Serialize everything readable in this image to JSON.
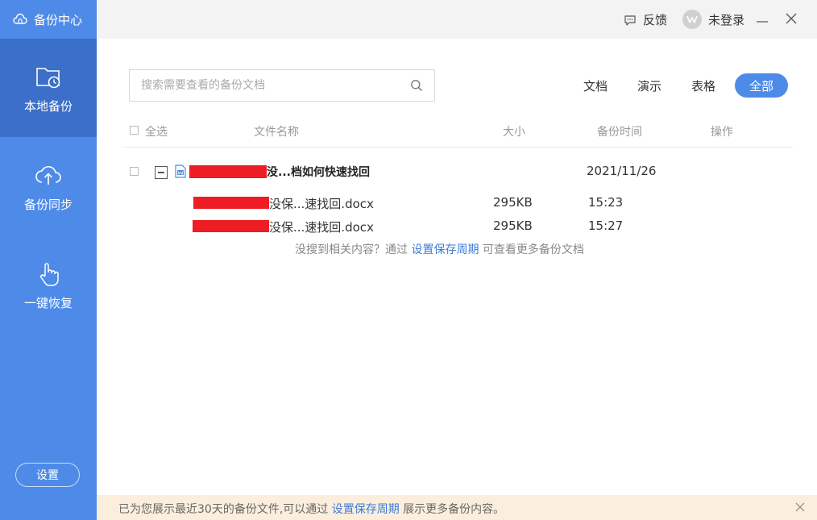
{
  "app": {
    "title": "备份中心"
  },
  "sidebar": {
    "items": [
      {
        "label": "本地备份",
        "icon": "folder-clock-icon",
        "active": true
      },
      {
        "label": "备份同步",
        "icon": "cloud-upload-icon",
        "active": false
      },
      {
        "label": "一键恢复",
        "icon": "hand-pointer-icon",
        "active": false
      }
    ],
    "settings_label": "设置"
  },
  "titlebar": {
    "feedback_label": "反馈",
    "user_label": "未登录",
    "avatar_letter": "W"
  },
  "search": {
    "placeholder": "搜索需要查看的备份文档"
  },
  "filters": [
    {
      "label": "文档",
      "active": false
    },
    {
      "label": "演示",
      "active": false
    },
    {
      "label": "表格",
      "active": false
    },
    {
      "label": "全部",
      "active": true
    }
  ],
  "table": {
    "headers": {
      "select_all": "全选",
      "name": "文件名称",
      "size": "大小",
      "time": "备份时间",
      "action": "操作"
    },
    "group": {
      "name": "没...档如何快速找回",
      "date": "2021/11/26",
      "files": [
        {
          "name": "没保...速找回.docx",
          "size": "295KB",
          "time": "15:23"
        },
        {
          "name": "没保...速找回.docx",
          "size": "295KB",
          "time": "15:27"
        }
      ]
    }
  },
  "hint": {
    "prefix": "没搜到相关内容？通过",
    "link": "设置保存周期",
    "suffix": "可查看更多备份文档"
  },
  "notice": {
    "prefix": "已为您展示最近30天的备份文件,可以通过",
    "link": "设置保存周期",
    "suffix": "展示更多备份内容。"
  },
  "colors": {
    "sidebar": "#4e8be8",
    "sidebar_active": "#3b6fc9",
    "accent": "#4e8be8",
    "link": "#3b7bd9",
    "redaction": "#ee1c25",
    "notice_bg": "#fbeedd"
  }
}
